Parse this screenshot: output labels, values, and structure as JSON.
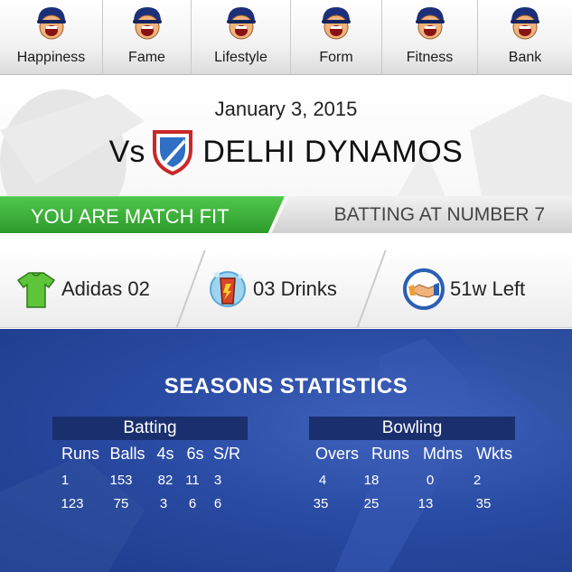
{
  "nav": {
    "items": [
      {
        "label": "Happiness"
      },
      {
        "label": "Fame"
      },
      {
        "label": "Lifestyle"
      },
      {
        "label": "Form"
      },
      {
        "label": "Fitness"
      },
      {
        "label": "Bank"
      }
    ]
  },
  "match": {
    "date": "January 3, 2015",
    "vs": "Vs",
    "opponent": "DELHI DYNAMOS",
    "fitness_status": "YOU ARE MATCH FIT",
    "batting_position": "BATTING AT NUMBER 7"
  },
  "info": {
    "kit": "Adidas 02",
    "drinks": "03 Drinks",
    "contract": "51w Left"
  },
  "stats": {
    "title": "SEASONS STATISTICS",
    "batting": {
      "title": "Batting",
      "columns": [
        "Runs",
        "Balls",
        "4s",
        "6s",
        "S/R"
      ],
      "rows": [
        [
          "1",
          "153",
          "82",
          "11",
          "3"
        ],
        [
          "123",
          "75",
          "3",
          "6",
          "6"
        ]
      ]
    },
    "bowling": {
      "title": "Bowling",
      "columns": [
        "Overs",
        "Runs",
        "Mdns",
        "Wkts"
      ],
      "rows": [
        [
          "4",
          "18",
          "0",
          "2"
        ],
        [
          "35",
          "25",
          "13",
          "35"
        ]
      ]
    }
  },
  "colors": {
    "fit_green": "#3cb03a",
    "stats_blue": "#2a4ba3",
    "header_navy": "#1a2f6e",
    "helmet_blue": "#1c2f7a"
  }
}
